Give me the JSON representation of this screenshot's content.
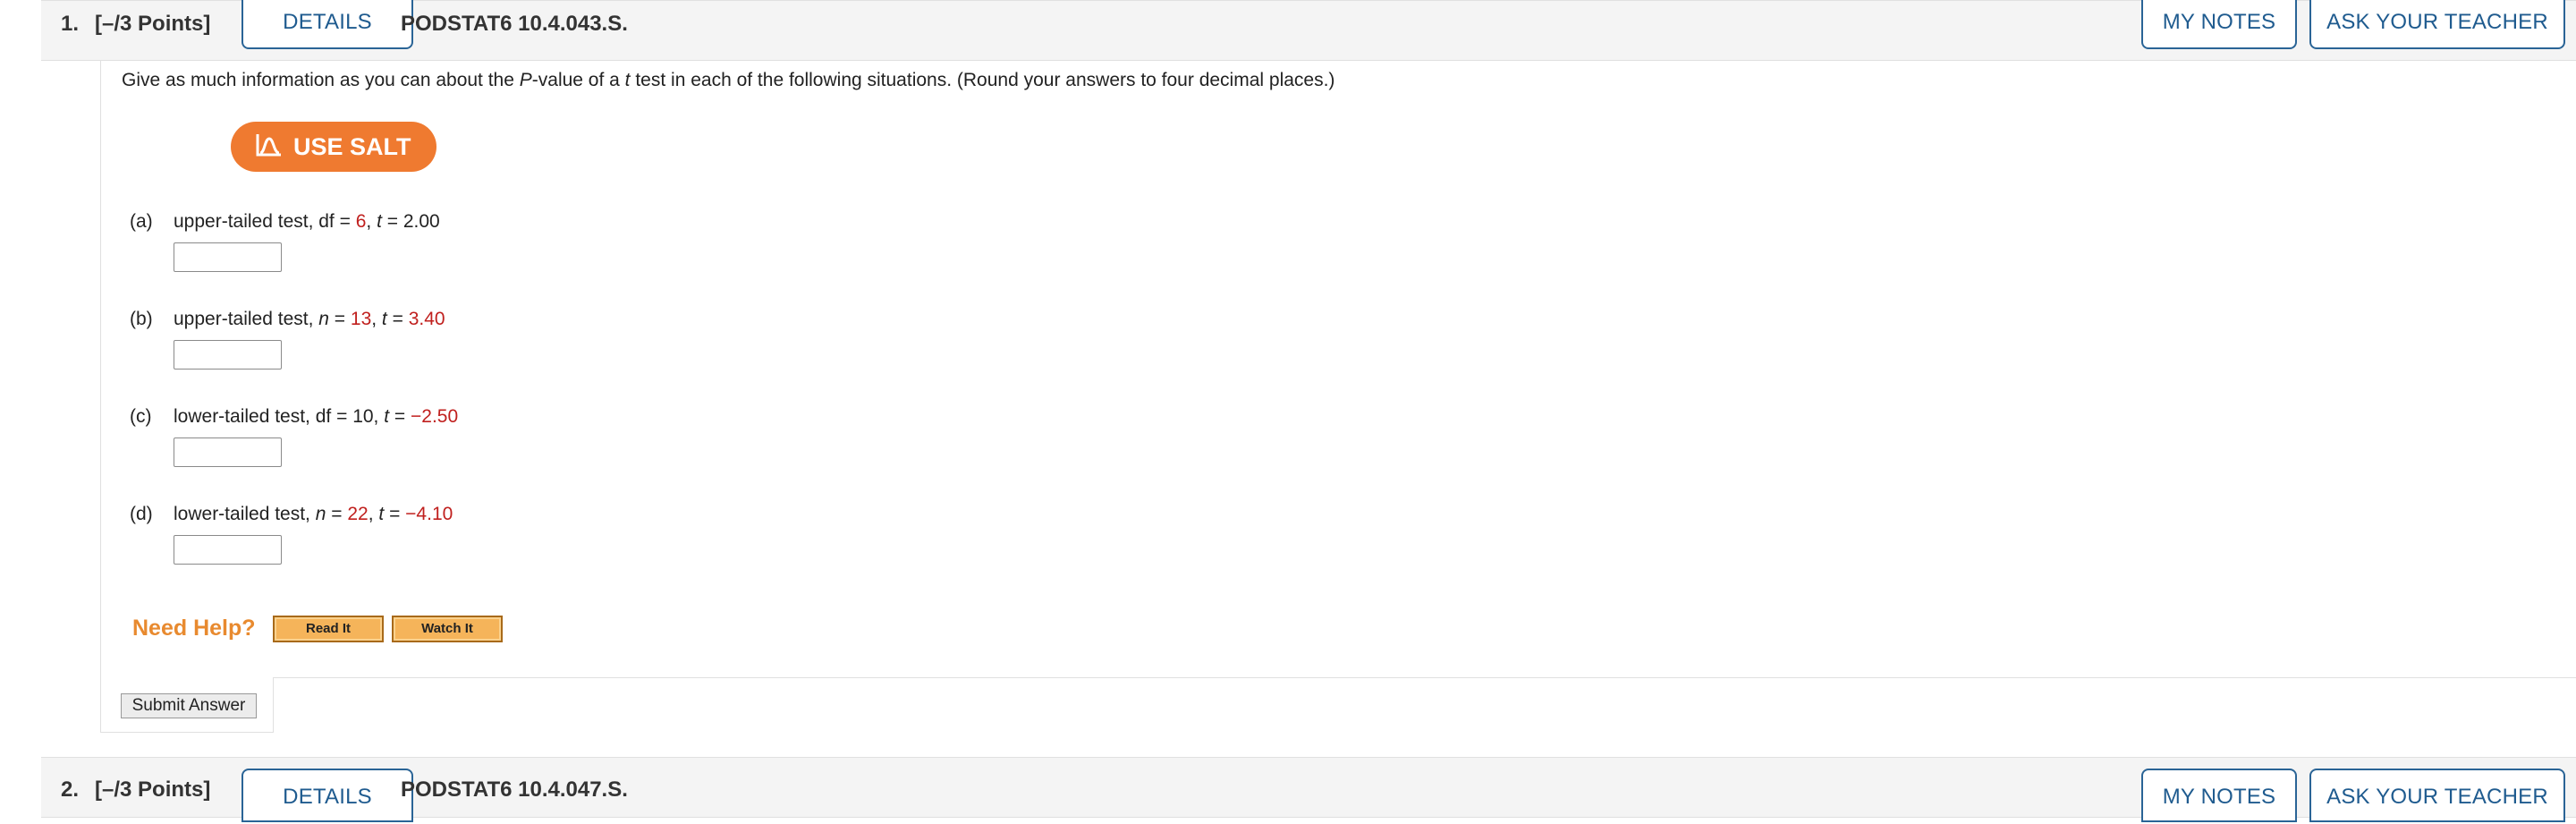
{
  "question1": {
    "number": "1.",
    "points": "[–/3 Points]",
    "details_label": "DETAILS",
    "code": "PODSTAT6 10.4.043.S.",
    "my_notes_label": "MY NOTES",
    "ask_teacher_label": "ASK YOUR TEACHER",
    "prompt": {
      "before": "Give as much information as you can about the ",
      "p": "P",
      "middle": "-value of a ",
      "t": "t",
      "after": " test in each of the following situations. (Round your answers to four decimal places.)"
    },
    "salt_label": "USE SALT",
    "parts": [
      {
        "label": "(a)",
        "text": "upper-tailed test, df = ",
        "v1": "6",
        "sep": ", ",
        "var2": "t",
        "eq2": " = ",
        "v2": "2.00"
      },
      {
        "label": "(b)",
        "text": "upper-tailed test, ",
        "var1": "n",
        "eq1": " = ",
        "v1": "13",
        "sep": ", ",
        "var2": "t",
        "eq2": " = ",
        "v2": "3.40"
      },
      {
        "label": "(c)",
        "text": "lower-tailed test, df = ",
        "v1": "10",
        "sep": ", ",
        "var2": "t",
        "eq2": " = ",
        "v2": "−2.50"
      },
      {
        "label": "(d)",
        "text": "lower-tailed test, ",
        "var1": "n",
        "eq1": " = ",
        "v1": "22",
        "sep": ", ",
        "var2": "t",
        "eq2": " = ",
        "v2": "−4.10"
      }
    ],
    "need_help": "Need Help?",
    "read_it": "Read It",
    "watch_it": "Watch It",
    "submit": "Submit Answer"
  },
  "question2": {
    "number": "2.",
    "points": "[–/3 Points]",
    "details_label": "DETAILS",
    "code": "PODSTAT6 10.4.047.S.",
    "my_notes_label": "MY NOTES",
    "ask_teacher_label": "ASK YOUR TEACHER"
  }
}
